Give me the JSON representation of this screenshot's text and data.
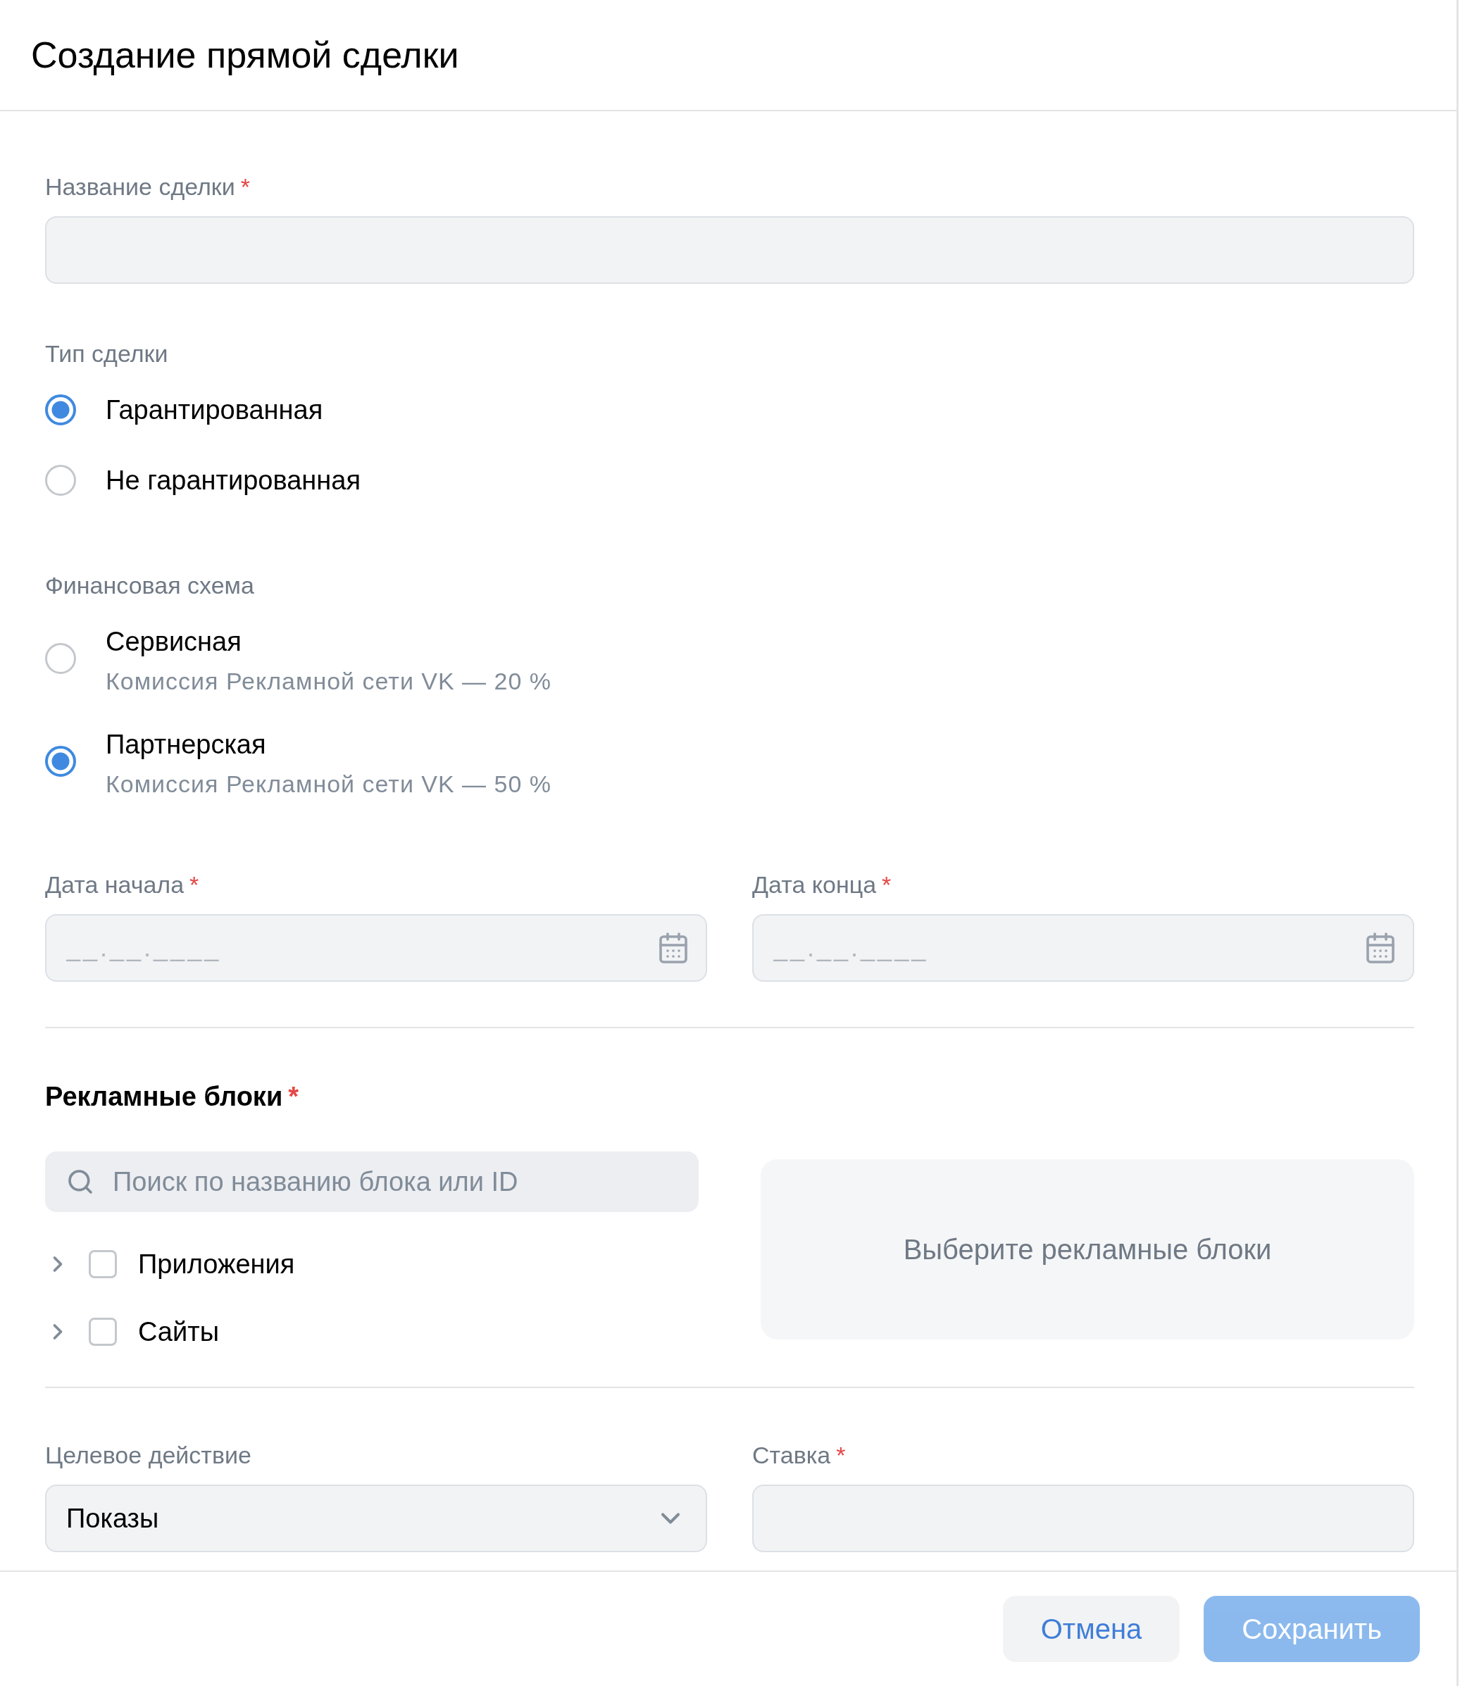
{
  "title": "Создание прямой сделки",
  "deal_name": {
    "label": "Название сделки",
    "mark": "*"
  },
  "deal_type": {
    "label": "Тип сделки",
    "options": [
      {
        "label": "Гарантированная",
        "selected": true
      },
      {
        "label": "Не гарантированная",
        "selected": false
      }
    ]
  },
  "finance_scheme": {
    "label": "Финансовая схема",
    "options": [
      {
        "label": "Сервисная",
        "note": "Комиссия Рекламной сети VK — 20 %",
        "selected": false
      },
      {
        "label": "Партнерская",
        "note": "Комиссия Рекламной сети VK — 50 %",
        "selected": true
      }
    ]
  },
  "dates": [
    {
      "label": "Дата начала",
      "mark": "*",
      "placeholder": "__.__.____"
    },
    {
      "label": "Дата конца",
      "mark": "*",
      "placeholder": "__.__.____"
    }
  ],
  "ad_blocks": {
    "title": "Рекламные блоки",
    "mark": "*",
    "search": {
      "placeholder": "Поиск по названию блока или ID"
    },
    "tree": [
      {
        "label": "Приложения",
        "checked": false,
        "expanded": false
      },
      {
        "label": "Сайты",
        "checked": false,
        "expanded": false
      }
    ],
    "empty_text": "Выберите рекламные блоки"
  },
  "target_action": {
    "label": "Целевое действие",
    "value": "Показы"
  },
  "rate": {
    "label": "Ставка",
    "mark": "*"
  },
  "buttons": [
    {
      "label": "Отмена",
      "kind": "secondary"
    },
    {
      "label": "Сохранить",
      "kind": "primary",
      "disabled": true
    }
  ]
}
